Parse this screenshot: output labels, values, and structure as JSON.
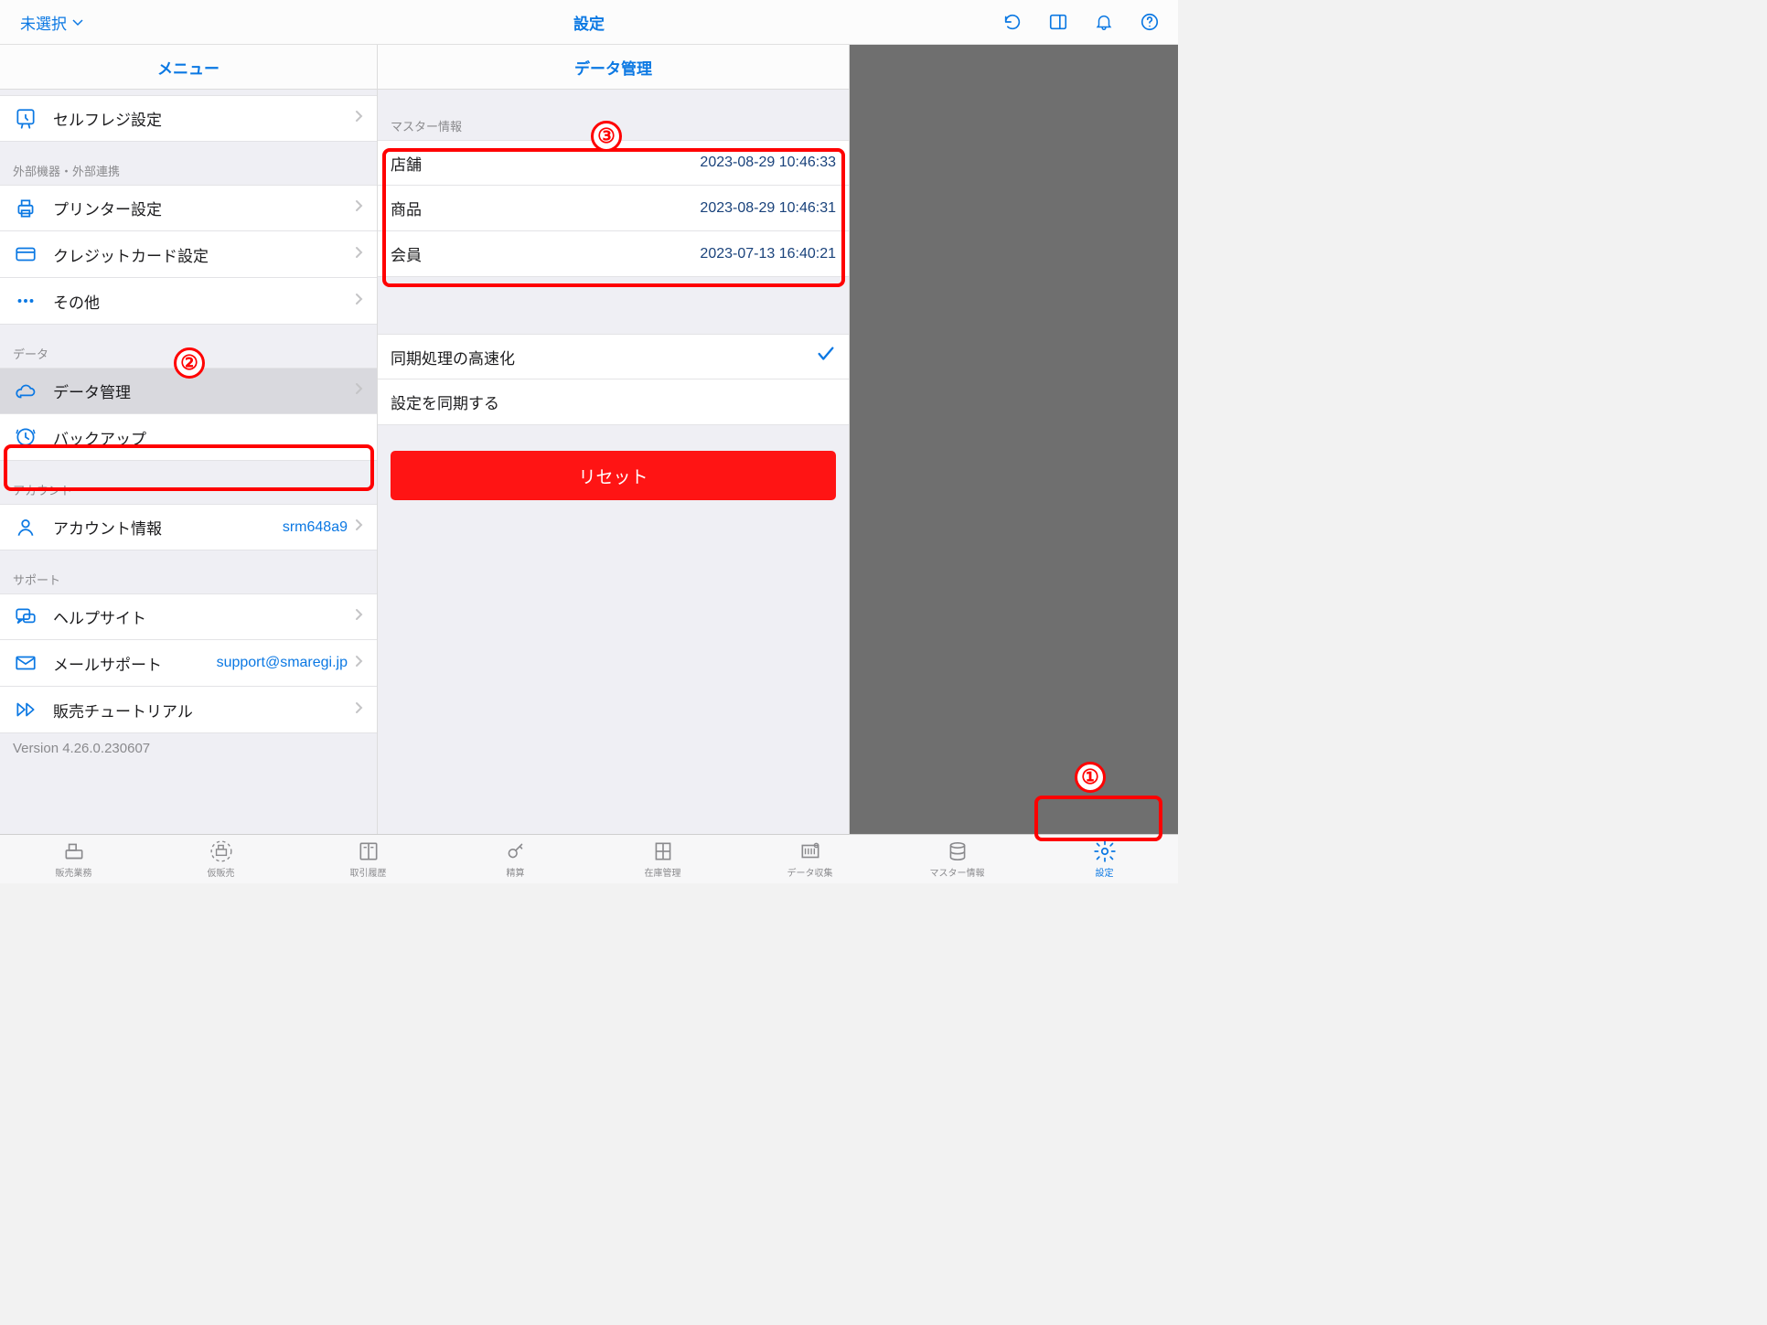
{
  "header": {
    "left_label": "未選択",
    "title": "設定"
  },
  "menu": {
    "title": "メニュー",
    "sections": [
      {
        "header": null,
        "rows": [
          {
            "icon": "self-checkout",
            "label": "セルフレジ設定",
            "value": null,
            "chevron": true
          }
        ]
      },
      {
        "header": "外部機器・外部連携",
        "rows": [
          {
            "icon": "printer",
            "label": "プリンター設定",
            "value": null,
            "chevron": true
          },
          {
            "icon": "card",
            "label": "クレジットカード設定",
            "value": null,
            "chevron": true
          },
          {
            "icon": "dots",
            "label": "その他",
            "value": null,
            "chevron": true
          }
        ]
      },
      {
        "header": "データ",
        "rows": [
          {
            "icon": "cloud",
            "label": "データ管理",
            "value": null,
            "chevron": true,
            "selected": true
          },
          {
            "icon": "clock",
            "label": "バックアップ",
            "value": null,
            "chevron": false
          }
        ]
      },
      {
        "header": "アカウント",
        "rows": [
          {
            "icon": "person",
            "label": "アカウント情報",
            "value": "srm648a9",
            "chevron": true
          }
        ]
      },
      {
        "header": "サポート",
        "rows": [
          {
            "icon": "chat",
            "label": "ヘルプサイト",
            "value": null,
            "chevron": true
          },
          {
            "icon": "mail",
            "label": "メールサポート",
            "value": "support@smaregi.jp",
            "chevron": true
          },
          {
            "icon": "forward",
            "label": "販売チュートリアル",
            "value": null,
            "chevron": true
          }
        ]
      }
    ],
    "version": "Version 4.26.0.230607"
  },
  "detail": {
    "title": "データ管理",
    "master_section_header": "マスター情報",
    "master_rows": [
      {
        "label": "店舗",
        "value": "2023-08-29 10:46:33"
      },
      {
        "label": "商品",
        "value": "2023-08-29 10:46:31"
      },
      {
        "label": "会員",
        "value": "2023-07-13 16:40:21"
      }
    ],
    "sync_fast_label": "同期処理の高速化",
    "sync_settings_label": "設定を同期する",
    "reset_label": "リセット"
  },
  "tabs": [
    {
      "label": "販売業務",
      "icon": "register"
    },
    {
      "label": "仮販売",
      "icon": "register-dashed"
    },
    {
      "label": "取引履歴",
      "icon": "book"
    },
    {
      "label": "精算",
      "icon": "key"
    },
    {
      "label": "在庫管理",
      "icon": "drawers"
    },
    {
      "label": "データ収集",
      "icon": "barcode"
    },
    {
      "label": "マスター情報",
      "icon": "database"
    },
    {
      "label": "設定",
      "icon": "gear",
      "active": true
    }
  ],
  "annotations": {
    "n1": "①",
    "n2": "②",
    "n3": "③"
  }
}
